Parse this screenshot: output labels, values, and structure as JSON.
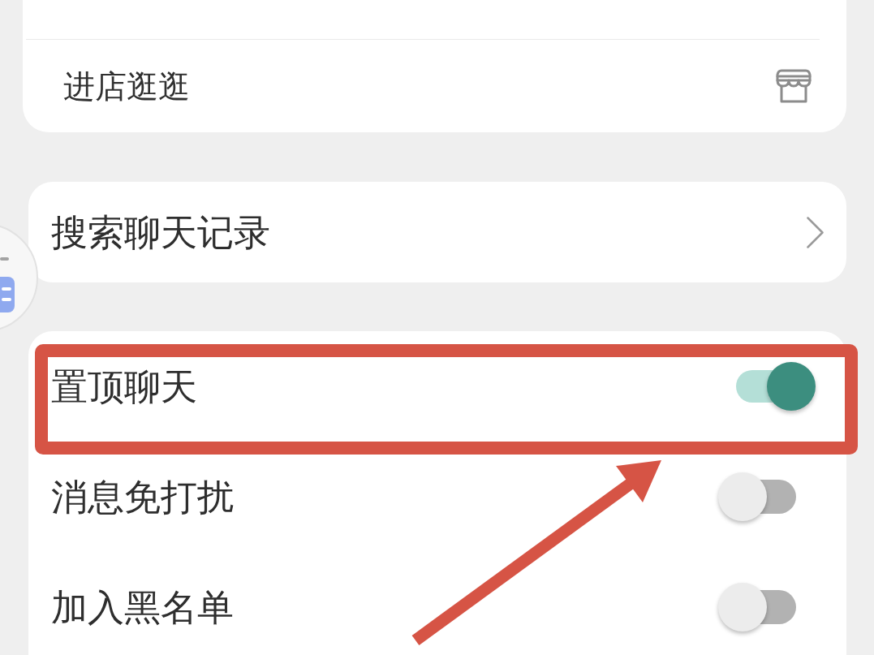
{
  "sections": [
    {
      "rows": [
        {
          "kind": "shop",
          "label": "进店逛逛",
          "highlighted": false
        }
      ]
    },
    {
      "rows": [
        {
          "kind": "nav",
          "label": "搜索聊天记录",
          "highlighted": false
        }
      ]
    },
    {
      "rows": [
        {
          "kind": "toggle",
          "label": "置顶聊天",
          "on": true,
          "highlighted": true
        },
        {
          "kind": "toggle",
          "label": "消息免打扰",
          "on": false,
          "highlighted": false
        },
        {
          "kind": "toggle",
          "label": "加入黑名单",
          "on": false,
          "highlighted": false
        }
      ]
    }
  ]
}
